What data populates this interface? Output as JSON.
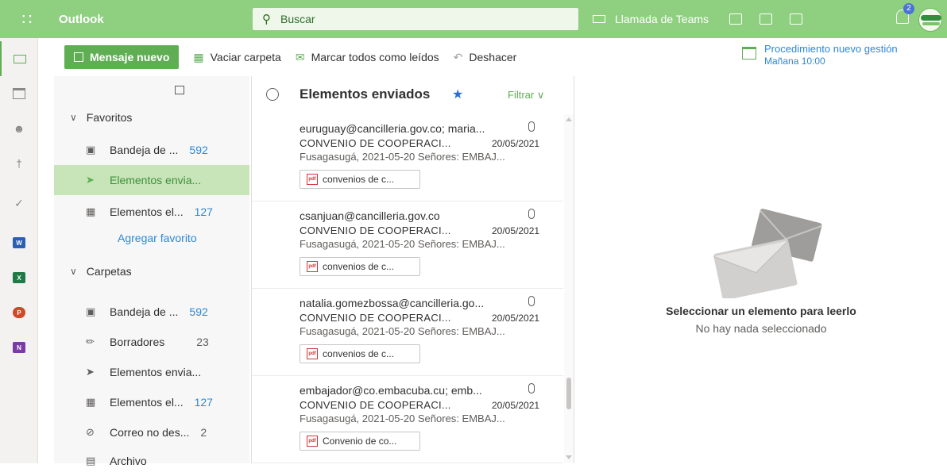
{
  "topbar": {
    "app_name": "Outlook",
    "search_placeholder": "Buscar",
    "teams_call": "Llamada de Teams",
    "notifications_count": "2"
  },
  "commands": {
    "new_message": "Mensaje nuevo",
    "empty_folder": "Vaciar carpeta",
    "mark_all_read": "Marcar todos como leídos",
    "undo": "Deshacer"
  },
  "reminder": {
    "title": "Procedimiento nuevo gestión",
    "time": "Mañana 10:00"
  },
  "folders": {
    "favorites_label": "Favoritos",
    "favorites": [
      {
        "label": "Bandeja de ...",
        "count": "592"
      },
      {
        "label": "Elementos envia...",
        "count": ""
      },
      {
        "label": "Elementos el...",
        "count": "127"
      }
    ],
    "add_favorite": "Agregar favorito",
    "folders_label": "Carpetas",
    "items": [
      {
        "label": "Bandeja de ...",
        "count": "592"
      },
      {
        "label": "Borradores",
        "count": "23"
      },
      {
        "label": "Elementos envia...",
        "count": ""
      },
      {
        "label": "Elementos el...",
        "count": "127"
      },
      {
        "label": "Correo no des...",
        "count": "2"
      },
      {
        "label": "Archivo",
        "count": ""
      }
    ]
  },
  "list": {
    "title": "Elementos enviados",
    "filter": "Filtrar",
    "messages": [
      {
        "from": "euruguay@cancilleria.gov.co; maria...",
        "subject": "CONVENIO DE COOPERACI...",
        "date": "20/05/2021",
        "preview": "Fusagasugá, 2021-05-20 Señores: EMBAJ...",
        "attachment": "convenios de c..."
      },
      {
        "from": "csanjuan@cancilleria.gov.co",
        "subject": "CONVENIO DE COOPERACI...",
        "date": "20/05/2021",
        "preview": "Fusagasugá, 2021-05-20 Señores: EMBAJ...",
        "attachment": "convenios de c..."
      },
      {
        "from": "natalia.gomezbossa@cancilleria.go...",
        "subject": "CONVENIO DE COOPERACI...",
        "date": "20/05/2021",
        "preview": "Fusagasugá, 2021-05-20 Señores: EMBAJ...",
        "attachment": "convenios de c..."
      },
      {
        "from": "embajador@co.embacuba.cu; emb...",
        "subject": "CONVENIO DE COOPERACI...",
        "date": "20/05/2021",
        "preview": "Fusagasugá, 2021-05-20 Señores: EMBAJ...",
        "attachment": "Convenio de co..."
      }
    ]
  },
  "reading": {
    "title": "Seleccionar un elemento para leerlo",
    "subtitle": "No hay nada seleccionado"
  },
  "colors": {
    "accent": "#5fae54",
    "topbar": "#8fcf80",
    "link": "#2b88d8",
    "selected": "#c7e5b8"
  }
}
